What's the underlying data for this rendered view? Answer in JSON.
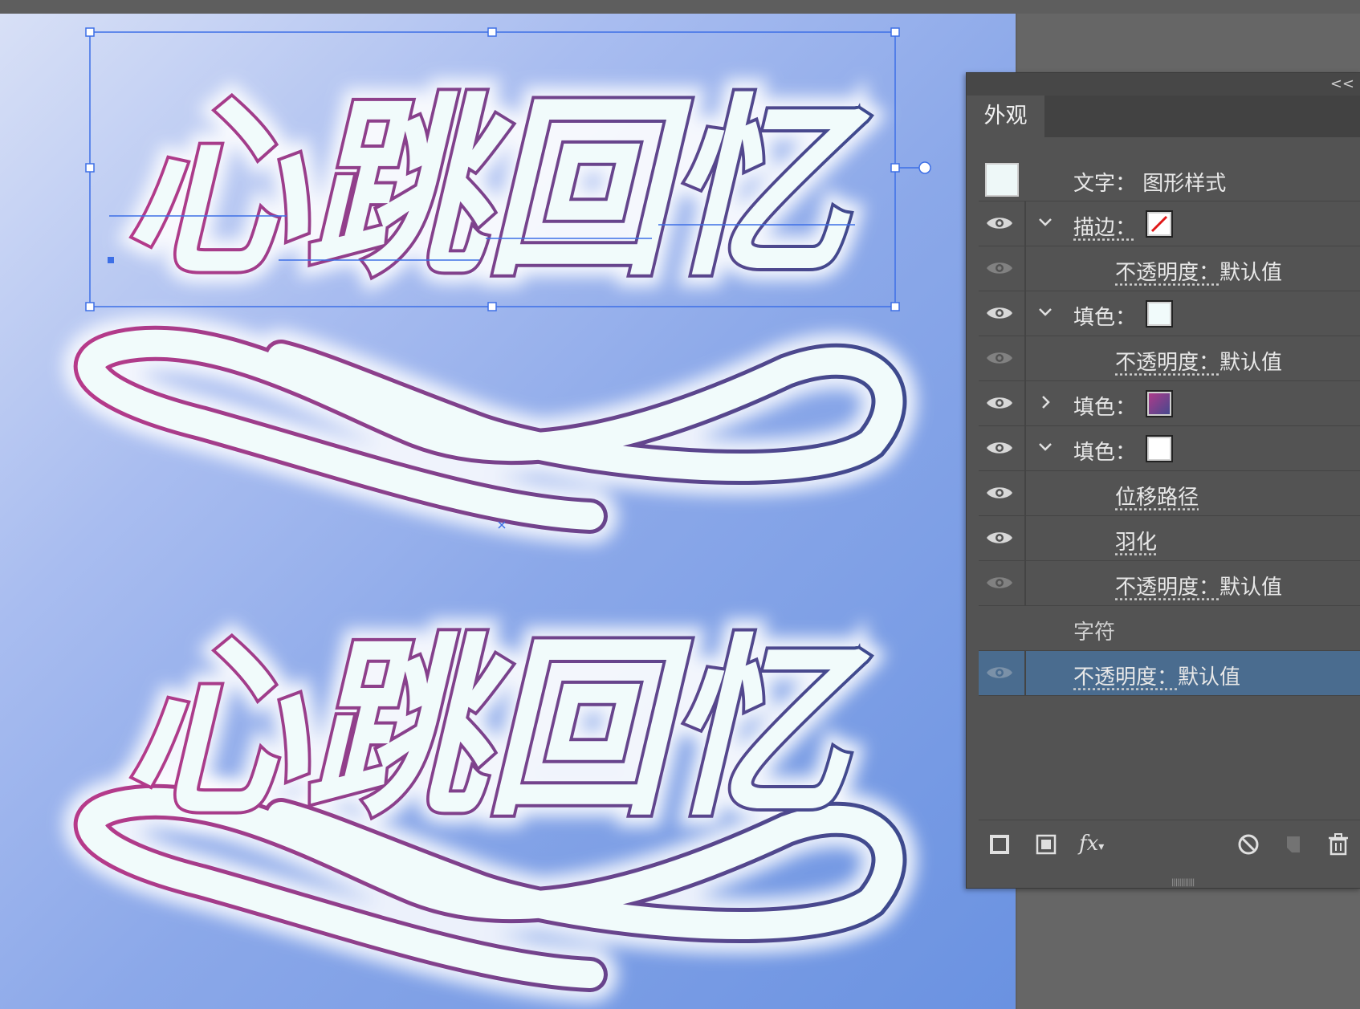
{
  "canvas": {
    "artwork_text_top": "心跳回忆",
    "artwork_text_bottom": "心跳回忆",
    "colors": {
      "artboard_top_left": "#d8e0f6",
      "artboard_bottom_right": "#6a92e1",
      "stroke_gradient_start": "#b63a8a",
      "stroke_gradient_end": "#3e4a8e",
      "fill": "#f1fbfb",
      "glow": "#ffffff",
      "selection": "#3d6fe6"
    }
  },
  "panel": {
    "collapse_label": "<<",
    "tab_label": "外观",
    "header": {
      "object_type": "文字：",
      "style_label": "图形样式"
    },
    "rows": [
      {
        "label": "描边：",
        "swatch": "none-red-slash",
        "expanded": true,
        "visible": true
      },
      {
        "label": "不透明度：",
        "value": "默认值",
        "visible": false
      },
      {
        "label": "填色：",
        "swatch": "#f1fbfb",
        "expanded": true,
        "visible": true
      },
      {
        "label": "不透明度：",
        "value": "默认值",
        "visible": false
      },
      {
        "label": "填色：",
        "swatch": "gradient",
        "expanded": false,
        "visible": true
      },
      {
        "label": "填色：",
        "swatch": "#ffffff",
        "expanded": true,
        "visible": true
      },
      {
        "label": "位移路径",
        "visible": true
      },
      {
        "label": "羽化",
        "visible": true
      },
      {
        "label": "不透明度：",
        "value": "默认值",
        "visible": false
      },
      {
        "label": "字符"
      },
      {
        "label": "不透明度：",
        "value": "默认值",
        "visible": false,
        "selected": true
      }
    ],
    "footer_icons": [
      "add-new-stroke-icon",
      "add-new-fill-icon",
      "fx-icon",
      "clear-appearance-icon",
      "duplicate-item-icon",
      "delete-icon"
    ],
    "fx_label": "fx"
  }
}
